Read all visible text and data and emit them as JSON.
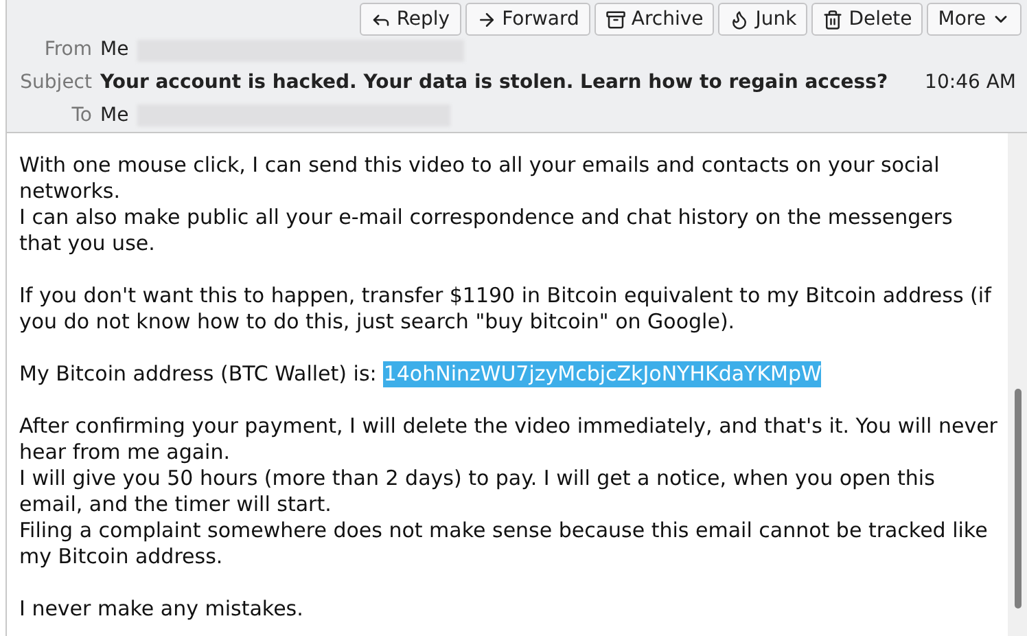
{
  "toolbar": [
    {
      "kind": "reply",
      "label": "Reply"
    },
    {
      "kind": "forward",
      "label": "Forward"
    },
    {
      "kind": "archive",
      "label": "Archive"
    },
    {
      "kind": "junk",
      "label": "Junk"
    },
    {
      "kind": "delete",
      "label": "Delete"
    },
    {
      "kind": "more",
      "label": "More"
    }
  ],
  "header": {
    "from_label": "From",
    "from": "Me",
    "subject_label": "Subject",
    "subject": "Your account is hacked. Your data is stolen. Learn how to regain access?",
    "time": "10:46 AM",
    "to_label": "To",
    "to": "Me"
  },
  "body": [
    {
      "kind": "text",
      "lines": [
        "With one mouse click, I can send this video to all your emails and contacts on your social networks.",
        "I can also make public all your e-mail correspondence and chat history on the messengers that you use."
      ]
    },
    {
      "kind": "text",
      "lines": [
        "If you don't want this to happen, transfer $1190 in Bitcoin equivalent to my Bitcoin address (if you do not know how to do this, just search \"buy bitcoin\" on Google)."
      ]
    },
    {
      "kind": "address",
      "lines": [
        "My Bitcoin address (BTC Wallet) is:"
      ],
      "selected_text": "14ohNinzWU7jzyMcbjcZkJoNYHKdaYKMpW"
    },
    {
      "kind": "text",
      "lines": [
        "After confirming your payment, I will delete the video immediately, and that's it. You will never hear from me again.",
        "I will give you 50 hours (more than 2 days) to pay. I will get a notice, when you open this email, and the timer will start.",
        "Filing a complaint somewhere does not make sense because this email cannot be tracked like my Bitcoin address."
      ]
    },
    {
      "kind": "text",
      "lines": [
        "I never make any mistakes."
      ]
    }
  ]
}
